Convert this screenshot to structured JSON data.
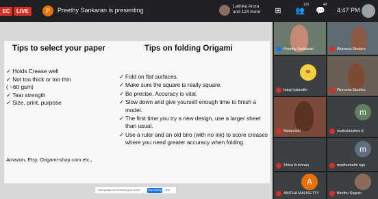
{
  "topbar": {
    "rec_label": "EC",
    "live_label": "LIVE",
    "presenter_initial": "P",
    "presenting_text": "Preethy Sankaran is presenting",
    "attendees_line1": "Lathika Arora",
    "attendees_line2": "and 124 more",
    "people_count": "125",
    "chat_count": "49",
    "time": "4:47 PM"
  },
  "slide": {
    "left_title": "Tips to select your paper",
    "right_title": "Tips on folding Origami",
    "left_items": [
      "✓ Holds Crease well",
      "✓ Not too thick or too thin",
      "( ~60 gsm)",
      "✓ Tear strength",
      "✓ Size, print, purpose"
    ],
    "right_items": [
      "Fold on flat surfaces.",
      "Make sure the square is really square.",
      "Be precise. Accuracy is vital.",
      "Slow down and give yourself enough time to finish a model.",
      "The first time you try a new design, use a larger sheet than usual.",
      "Use a ruler and an old biro (with no ink) to score creases where you need greater accuracy when folding."
    ],
    "check_mark": "✓",
    "buy_text": "Amazon, Etsy, Origami-shop.com etc.,"
  },
  "share_bar": {
    "text": "meet.google.com is sharing your screen.",
    "stop_label": "Stop sharing",
    "hide_label": "Hide"
  },
  "participants": [
    {
      "name": "Preethy Sankaran"
    },
    {
      "name": "Womens Studies"
    },
    {
      "name": "balaji kalanithi"
    },
    {
      "name": "Womens Studies"
    },
    {
      "name": "Malarvizhi"
    },
    {
      "name": "muthulakshmi d"
    },
    {
      "name": "Shiva Krishnan"
    },
    {
      "name": "madhumathi raja"
    },
    {
      "name": "ANITHA MALISETTY"
    },
    {
      "name": "Bindhu Rajesh"
    }
  ],
  "avatar_letters": {
    "m1": "m",
    "m2": "m",
    "a": "A"
  }
}
